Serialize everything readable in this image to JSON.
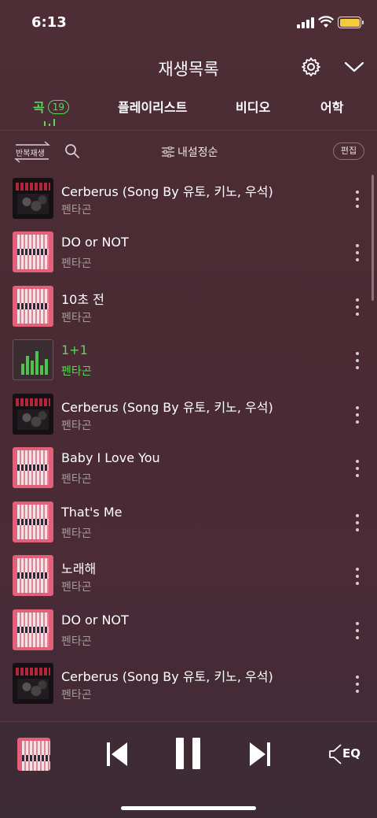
{
  "status_bar": {
    "time": "6:13"
  },
  "header": {
    "title": "재생목록"
  },
  "tabs": [
    {
      "label": "곡",
      "count": "19"
    },
    {
      "label": "플레이리스트"
    },
    {
      "label": "비디오"
    },
    {
      "label": "어학"
    }
  ],
  "toolbar": {
    "repeat_label": "반복재생",
    "sort_label": "내설정순",
    "edit_label": "편집"
  },
  "tracks": [
    {
      "title": "Cerberus (Song By 유토, 키노, 우석)",
      "artist": "펜타곤",
      "art": "dark"
    },
    {
      "title": "DO or NOT",
      "artist": "펜타곤",
      "art": "pink"
    },
    {
      "title": "10초 전",
      "artist": "펜타곤",
      "art": "pink"
    },
    {
      "title": "1+1",
      "artist": "펜타곤",
      "art": "playing",
      "now_playing": true
    },
    {
      "title": "Cerberus (Song By 유토, 키노, 우석)",
      "artist": "펜타곤",
      "art": "dark"
    },
    {
      "title": "Baby I Love You",
      "artist": "펜타곤",
      "art": "pink"
    },
    {
      "title": "That's Me",
      "artist": "펜타곤",
      "art": "pink"
    },
    {
      "title": "노래해",
      "artist": "펜타곤",
      "art": "pink"
    },
    {
      "title": "DO or NOT",
      "artist": "펜타곤",
      "art": "pink"
    },
    {
      "title": "Cerberus (Song By 유토, 키노, 우석)",
      "artist": "펜타곤",
      "art": "dark"
    }
  ],
  "player": {
    "eq_label": "EQ",
    "state": "playing"
  },
  "colors": {
    "accent": "#5bd65b",
    "background": "#4a2b34",
    "secondary_text": "#a8999d"
  },
  "icons": [
    "gear-icon",
    "chevron-down-icon",
    "search-icon",
    "repeat-icon",
    "sort-icon",
    "more-icon",
    "previous-icon",
    "pause-icon",
    "next-icon",
    "eq-icon"
  ]
}
